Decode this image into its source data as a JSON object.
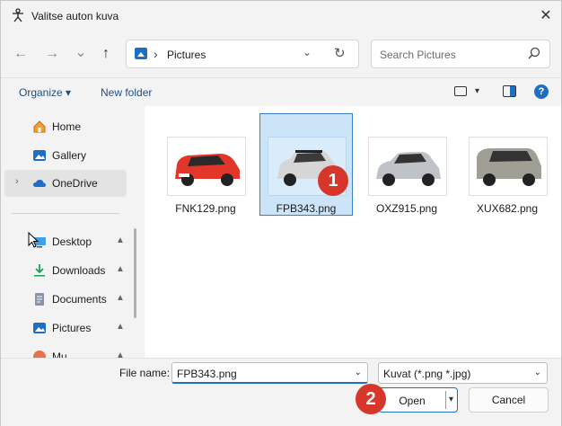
{
  "window": {
    "title": "Valitse auton kuva",
    "close_glyph": "✕"
  },
  "nav_buttons": {
    "back": "←",
    "forward": "→",
    "recent": "⌄",
    "up": "↑"
  },
  "address": {
    "separator": "›",
    "crumb": "Pictures",
    "dropdown": "⌄",
    "refresh": "↻"
  },
  "search": {
    "placeholder": "Search Pictures"
  },
  "toolbar": {
    "organize": "Organize ▾",
    "new_folder": "New folder",
    "view_dropdown": "▾",
    "help": "?"
  },
  "nav_pane": {
    "items": [
      {
        "label": "Home",
        "icon": "home-icon"
      },
      {
        "label": "Gallery",
        "icon": "gallery-icon"
      },
      {
        "label": "OneDrive",
        "icon": "cloud-icon",
        "expander": "›",
        "selected": true
      },
      {
        "label": "Desktop",
        "icon": "desktop-icon",
        "pin": "📌"
      },
      {
        "label": "Downloads",
        "icon": "download-icon",
        "pin": "📌"
      },
      {
        "label": "Documents",
        "icon": "documents-icon",
        "pin": "📌"
      },
      {
        "label": "Pictures",
        "icon": "pictures-icon",
        "pin": "📌"
      },
      {
        "label": "Mu",
        "icon": "music-icon",
        "pin": "📌"
      }
    ]
  },
  "files": [
    {
      "name": "FNK129.png",
      "car_color": "#e2362b",
      "selected": false
    },
    {
      "name": "FPB343.png",
      "car_color": "#c9c9c9",
      "selected": true
    },
    {
      "name": "OXZ915.png",
      "car_color": "#b8bcc0",
      "selected": false
    },
    {
      "name": "XUX682.png",
      "car_color": "#9a9a92",
      "selected": false
    }
  ],
  "annotations": {
    "badge1": "1",
    "badge2": "2"
  },
  "bottom": {
    "file_name_label": "File name:",
    "file_name_value": "FPB343.png",
    "file_type_value": "Kuvat (*.png *.jpg)",
    "dropdown": "⌄",
    "open_label": "Open",
    "open_split": "▾",
    "cancel_label": "Cancel"
  },
  "colors": {
    "accent": "#1e6fc4",
    "selection": "#cce4f7",
    "badge": "#d7362a"
  }
}
